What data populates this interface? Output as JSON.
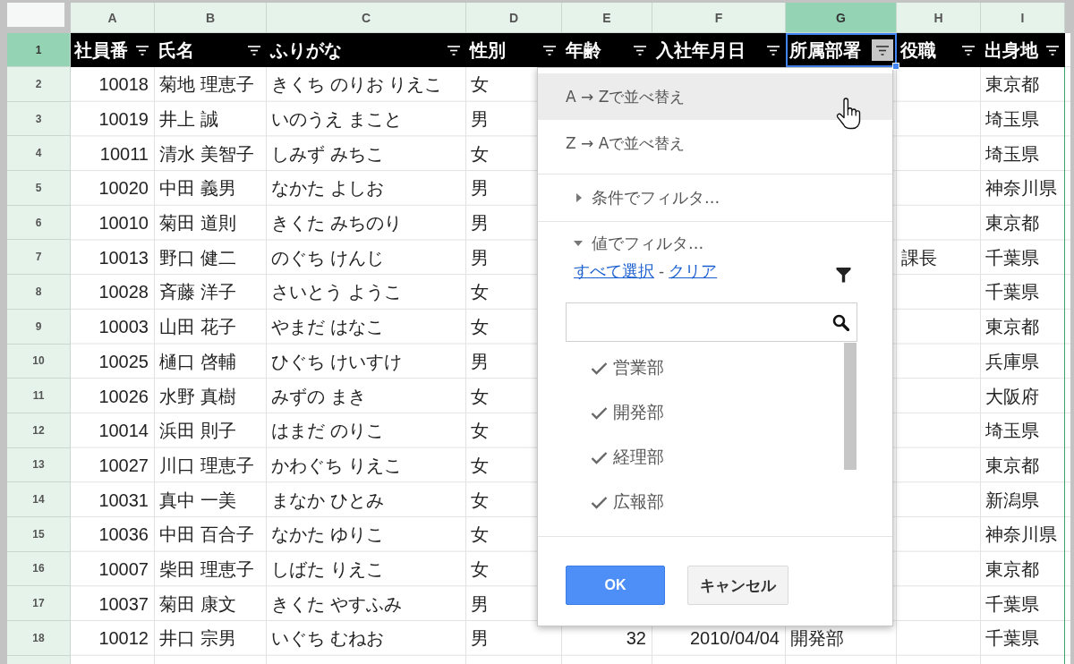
{
  "column_letters": [
    {
      "label": "A",
      "selected": false
    },
    {
      "label": "B",
      "selected": false
    },
    {
      "label": "C",
      "selected": false
    },
    {
      "label": "D",
      "selected": false
    },
    {
      "label": "E",
      "selected": false
    },
    {
      "label": "F",
      "selected": false
    },
    {
      "label": "G",
      "selected": true
    },
    {
      "label": "H",
      "selected": false
    },
    {
      "label": "I",
      "selected": false
    }
  ],
  "header_row": {
    "row_number": "1",
    "selected": true,
    "cells": [
      {
        "label": "社員番",
        "selected": false
      },
      {
        "label": "氏名",
        "selected": false
      },
      {
        "label": "ふりがな",
        "selected": false
      },
      {
        "label": "性別",
        "selected": false
      },
      {
        "label": "年齢",
        "selected": false
      },
      {
        "label": "入社年月日",
        "selected": false
      },
      {
        "label": "所属部署",
        "selected": true
      },
      {
        "label": "役職",
        "selected": false
      },
      {
        "label": "出身地",
        "selected": false
      }
    ]
  },
  "rows": [
    {
      "row_number": "2",
      "selected": false,
      "employee_id": "10018",
      "name": "菊地 理恵子",
      "furigana": "きくち のりお りえこ",
      "gender": "女",
      "birthplace": "東京都"
    },
    {
      "row_number": "3",
      "selected": false,
      "employee_id": "10019",
      "name": "井上 誠",
      "furigana": "いのうえ まこと",
      "gender": "男",
      "birthplace": "埼玉県"
    },
    {
      "row_number": "4",
      "selected": false,
      "employee_id": "10011",
      "name": "清水 美智子",
      "furigana": "しみず みちこ",
      "gender": "女",
      "birthplace": "埼玉県"
    },
    {
      "row_number": "5",
      "selected": false,
      "employee_id": "10020",
      "name": "中田 義男",
      "furigana": "なかた よしお",
      "gender": "男",
      "birthplace": "神奈川県"
    },
    {
      "row_number": "6",
      "selected": false,
      "employee_id": "10010",
      "name": "菊田 道則",
      "furigana": "きくた みちのり",
      "gender": "男",
      "birthplace": "東京都"
    },
    {
      "row_number": "7",
      "selected": false,
      "employee_id": "10013",
      "name": "野口 健二",
      "furigana": "のぐち けんじ",
      "gender": "男",
      "position": "課長",
      "birthplace": "千葉県"
    },
    {
      "row_number": "8",
      "selected": false,
      "employee_id": "10028",
      "name": "斉藤 洋子",
      "furigana": "さいとう ようこ",
      "gender": "女",
      "birthplace": "千葉県"
    },
    {
      "row_number": "9",
      "selected": false,
      "employee_id": "10003",
      "name": "山田 花子",
      "furigana": "やまだ はなこ",
      "gender": "女",
      "birthplace": "東京都"
    },
    {
      "row_number": "10",
      "selected": false,
      "employee_id": "10025",
      "name": "樋口 啓輔",
      "furigana": "ひぐち けいすけ",
      "gender": "男",
      "birthplace": "兵庫県"
    },
    {
      "row_number": "11",
      "selected": false,
      "employee_id": "10026",
      "name": "水野 真樹",
      "furigana": "みずの まき",
      "gender": "女",
      "birthplace": "大阪府"
    },
    {
      "row_number": "12",
      "selected": false,
      "employee_id": "10014",
      "name": "浜田 則子",
      "furigana": "はまだ のりこ",
      "gender": "女",
      "birthplace": "埼玉県"
    },
    {
      "row_number": "13",
      "selected": false,
      "employee_id": "10027",
      "name": "川口 理恵子",
      "furigana": "かわぐち りえこ",
      "gender": "女",
      "birthplace": "東京都"
    },
    {
      "row_number": "14",
      "selected": false,
      "employee_id": "10031",
      "name": "真中 一美",
      "furigana": "まなか ひとみ",
      "gender": "女",
      "birthplace": "新潟県"
    },
    {
      "row_number": "15",
      "selected": false,
      "employee_id": "10036",
      "name": "中田 百合子",
      "furigana": "なかた ゆりこ",
      "gender": "女",
      "birthplace": "神奈川県"
    },
    {
      "row_number": "16",
      "selected": false,
      "employee_id": "10007",
      "name": "柴田 理恵子",
      "furigana": "しばた りえこ",
      "gender": "女",
      "birthplace": "東京都"
    },
    {
      "row_number": "17",
      "selected": false,
      "employee_id": "10037",
      "name": "菊田 康文",
      "furigana": "きくた やすふみ",
      "gender": "男",
      "birthplace": "千葉県"
    },
    {
      "row_number": "18",
      "selected": false,
      "employee_id": "10012",
      "name": "井口 宗男",
      "furigana": "いぐち むねお",
      "gender": "男",
      "age": "32",
      "hire_date": "2010/04/04",
      "department": "開発部",
      "birthplace": "千葉県"
    }
  ],
  "filter_menu": {
    "sort_options": [
      {
        "label": "A → Zで並べ替え",
        "highlighted": true
      },
      {
        "label": "Z → Aで並べ替え",
        "highlighted": false
      }
    ],
    "filter_sections": [
      {
        "label": "条件でフィルタ...",
        "expanded": false
      },
      {
        "label": "値でフィルタ...",
        "expanded": true,
        "select_all_link": "すべて選択",
        "link_separator": "-",
        "clear_link": "クリア",
        "values": [
          {
            "label": "営業部",
            "checked": true
          },
          {
            "label": "開発部",
            "checked": true
          },
          {
            "label": "経理部",
            "checked": true
          },
          {
            "label": "広報部",
            "checked": true
          }
        ]
      }
    ],
    "buttons": [
      {
        "label": "OK",
        "kind": "primary"
      },
      {
        "label": "キャンセル",
        "kind": "secondary"
      }
    ]
  }
}
